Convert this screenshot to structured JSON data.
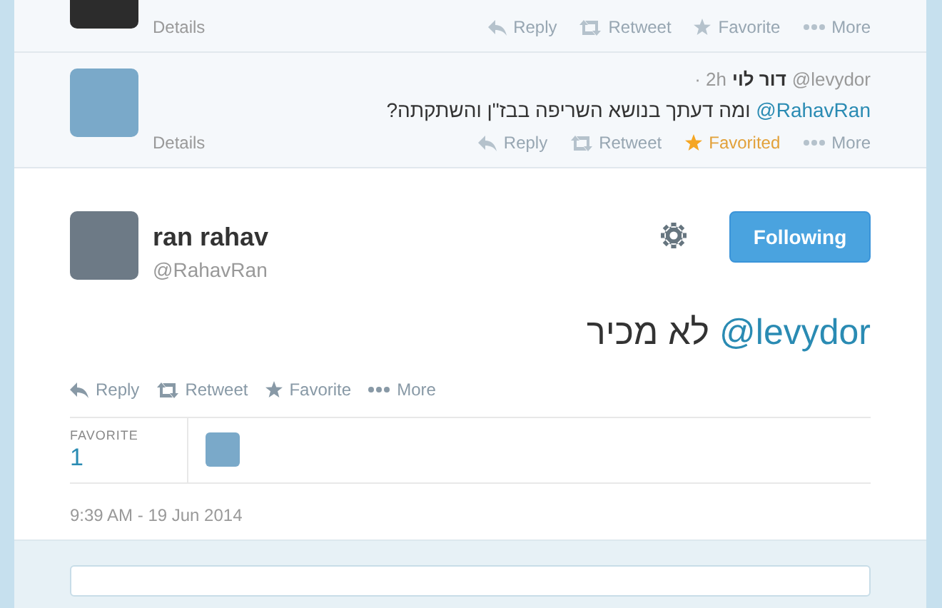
{
  "replies": [
    {
      "details": "Details",
      "actions": [
        {
          "kind": "reply",
          "label": "Reply",
          "selected": false
        },
        {
          "kind": "retweet",
          "label": "Retweet",
          "selected": false
        },
        {
          "kind": "favorite",
          "label": "Favorite",
          "selected": false
        },
        {
          "kind": "more",
          "label": "More",
          "selected": false
        }
      ]
    },
    {
      "name": "דור לוי",
      "handle": "@levydor",
      "sep": "·",
      "time": "2h",
      "mention": "@RahavRan",
      "text": "ומה דעתך בנושא השריפה בבז\"ן והשתקתה?",
      "details": "Details",
      "actions": [
        {
          "kind": "reply",
          "label": "Reply",
          "selected": false
        },
        {
          "kind": "retweet",
          "label": "Retweet",
          "selected": false
        },
        {
          "kind": "favorite",
          "label": "Favorited",
          "selected": true
        },
        {
          "kind": "more",
          "label": "More",
          "selected": false
        }
      ]
    }
  ],
  "tweet": {
    "name": "ran rahav",
    "handle": "@RahavRan",
    "follow": {
      "label": "Following",
      "selected": true
    },
    "mention": "@levydor",
    "text": "לא מכיר",
    "actions": [
      {
        "kind": "reply",
        "label": "Reply",
        "selected": false
      },
      {
        "kind": "retweet",
        "label": "Retweet",
        "selected": false
      },
      {
        "kind": "favorite",
        "label": "Favorite",
        "selected": false
      },
      {
        "kind": "more",
        "label": "More",
        "selected": false
      }
    ],
    "stats": {
      "label": "FAVORITE",
      "count": "1"
    },
    "timestamp": "9:39 AM - 19 Jun 2014"
  }
}
